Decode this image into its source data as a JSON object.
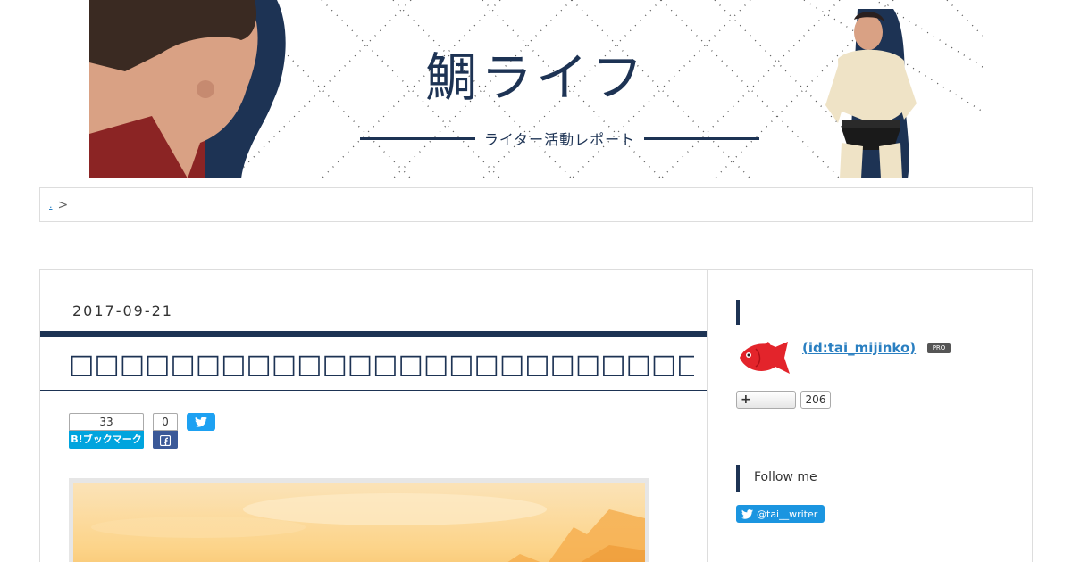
{
  "header": {
    "blog_title": "鯛ライフ",
    "blog_subtitle": "ライター活動レポート"
  },
  "breadcrumb": {
    "home_label": ".",
    "separator": ">"
  },
  "entry": {
    "date": "2017-09-21",
    "title": "□□□□□□□□□□□□□□□□□□□□□□□□□□□□□□□□□□□□□"
  },
  "share": {
    "hatena_count": "33",
    "hatena_label": "B!ブックマーク",
    "facebook_count": "0",
    "facebook_icon": "facebook-icon",
    "twitter_icon": "twitter-icon"
  },
  "sidebar": {
    "profile": {
      "user_id": " (id:tai_mijinko)",
      "pro_badge": "PRO",
      "avatar_icon": "red-fish-avatar"
    },
    "subscribe": {
      "label": "+",
      "count": "206"
    },
    "follow": {
      "heading": "Follow me",
      "twitter_handle": "@tai__writer"
    }
  },
  "colors": {
    "navy": "#1d3354",
    "link": "#2a7fc1",
    "hatena": "#00a4de",
    "facebook": "#3b5998",
    "twitter": "#1da1f2"
  }
}
